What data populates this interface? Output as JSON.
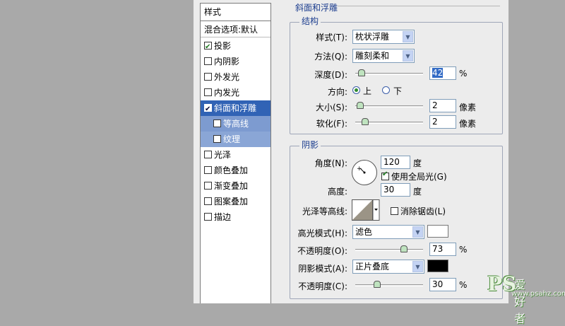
{
  "left_panel": {
    "title": "样式",
    "blending": "混合选项:默认",
    "items": [
      {
        "label": "投影",
        "checked": true
      },
      {
        "label": "内阴影",
        "checked": false
      },
      {
        "label": "外发光",
        "checked": false
      },
      {
        "label": "内发光",
        "checked": false
      },
      {
        "label": "斜面和浮雕",
        "checked": true,
        "selected": true
      },
      {
        "label": "等高线",
        "checked": false,
        "sub": true
      },
      {
        "label": "纹理",
        "checked": false,
        "sub": true
      },
      {
        "label": "光泽",
        "checked": false
      },
      {
        "label": "颜色叠加",
        "checked": false
      },
      {
        "label": "渐变叠加",
        "checked": false
      },
      {
        "label": "图案叠加",
        "checked": false
      },
      {
        "label": "描边",
        "checked": false
      }
    ]
  },
  "bevel": {
    "section_title": "斜面和浮雕",
    "structure_title": "结构",
    "style_label": "样式(T):",
    "style_value": "枕状浮雕",
    "technique_label": "方法(Q):",
    "technique_value": "雕刻柔和",
    "depth_label": "深度(D):",
    "depth_value": "42",
    "depth_fraction": 0.04,
    "percent": "%",
    "direction_label": "方向:",
    "direction_up": "上",
    "direction_down": "下",
    "size_label": "大小(S):",
    "size_value": "2",
    "size_fraction": 0.02,
    "soften_label": "软化(F):",
    "soften_value": "2",
    "soften_fraction": 0.1,
    "px_unit": "像素"
  },
  "shading": {
    "title": "阴影",
    "angle_label": "角度(N):",
    "angle_value": "120",
    "degree_unit": "度",
    "global_light_label": "使用全局光(G)",
    "global_light_checked": true,
    "altitude_label": "高度:",
    "altitude_value": "30",
    "gloss_contour_label": "光泽等高线:",
    "anti_alias_label": "消除锯齿(L)",
    "anti_alias_checked": false,
    "highlight_mode_label": "高光模式(H):",
    "highlight_mode_value": "滤色",
    "highlight_color": "#ffffff",
    "highlight_opacity_label": "不透明度(O):",
    "highlight_opacity_value": "73",
    "highlight_opacity_fraction": 0.73,
    "shadow_mode_label": "阴影模式(A):",
    "shadow_mode_value": "正片叠底",
    "shadow_color": "#000000",
    "shadow_opacity_label": "不透明度(C):",
    "shadow_opacity_value": "30",
    "shadow_opacity_fraction": 0.3,
    "percent": "%"
  },
  "watermark": {
    "ps": "PS",
    "name": "爱好者",
    "url": "www.psahz.com"
  }
}
